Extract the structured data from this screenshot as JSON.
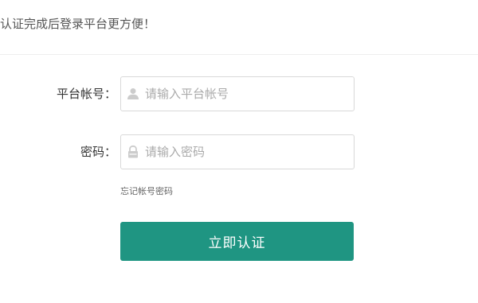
{
  "notice": {
    "text": "认证完成后登录平台更方便！"
  },
  "form": {
    "account": {
      "label": "平台帐号：",
      "placeholder": "请输入平台帐号",
      "value": "",
      "icon": "user-icon"
    },
    "password": {
      "label": "密码：",
      "placeholder": "请输入密码",
      "value": "",
      "icon": "lock-icon"
    },
    "forgot_label": "忘记帐号密码",
    "submit_label": "立即认证"
  },
  "colors": {
    "accent": "#1f9582",
    "icon": "#cccccc",
    "placeholder": "#aaaaaa"
  }
}
